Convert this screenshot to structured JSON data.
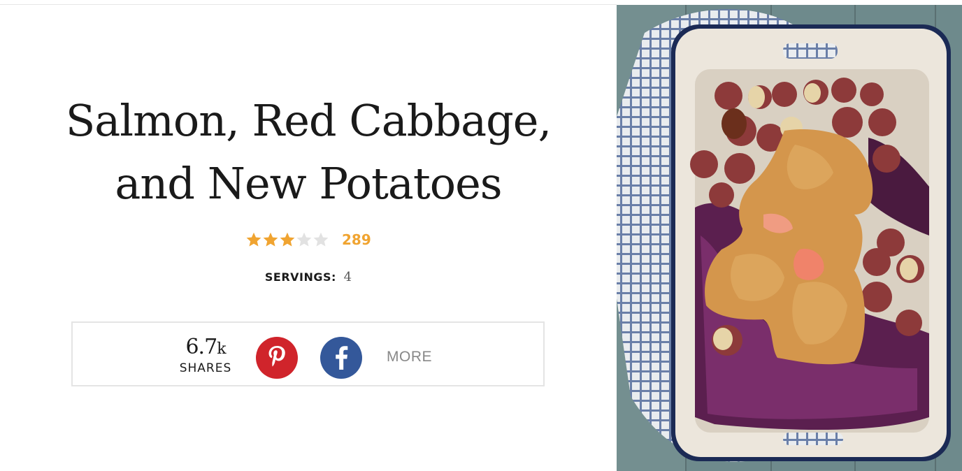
{
  "recipe": {
    "title_line1": "Salmon, Red Cabbage,",
    "title_line2": "and New Potatoes",
    "rating": {
      "stars_filled": 3,
      "stars_total": 5,
      "count": "289"
    },
    "servings": {
      "label": "SERVINGS:",
      "value": "4"
    }
  },
  "share": {
    "count_number": "6.7",
    "count_suffix": "k",
    "count_label": "SHARES",
    "pinterest_icon": "pinterest-icon",
    "facebook_icon": "facebook-icon",
    "more_label": "MORE"
  },
  "colors": {
    "star_filled": "#f0a431",
    "star_empty": "#e2e2e2",
    "pinterest": "#d0242b",
    "facebook": "#34589a",
    "more_text": "#888888"
  },
  "photo": {
    "subject": "salmon-cabbage-potatoes-photo"
  }
}
